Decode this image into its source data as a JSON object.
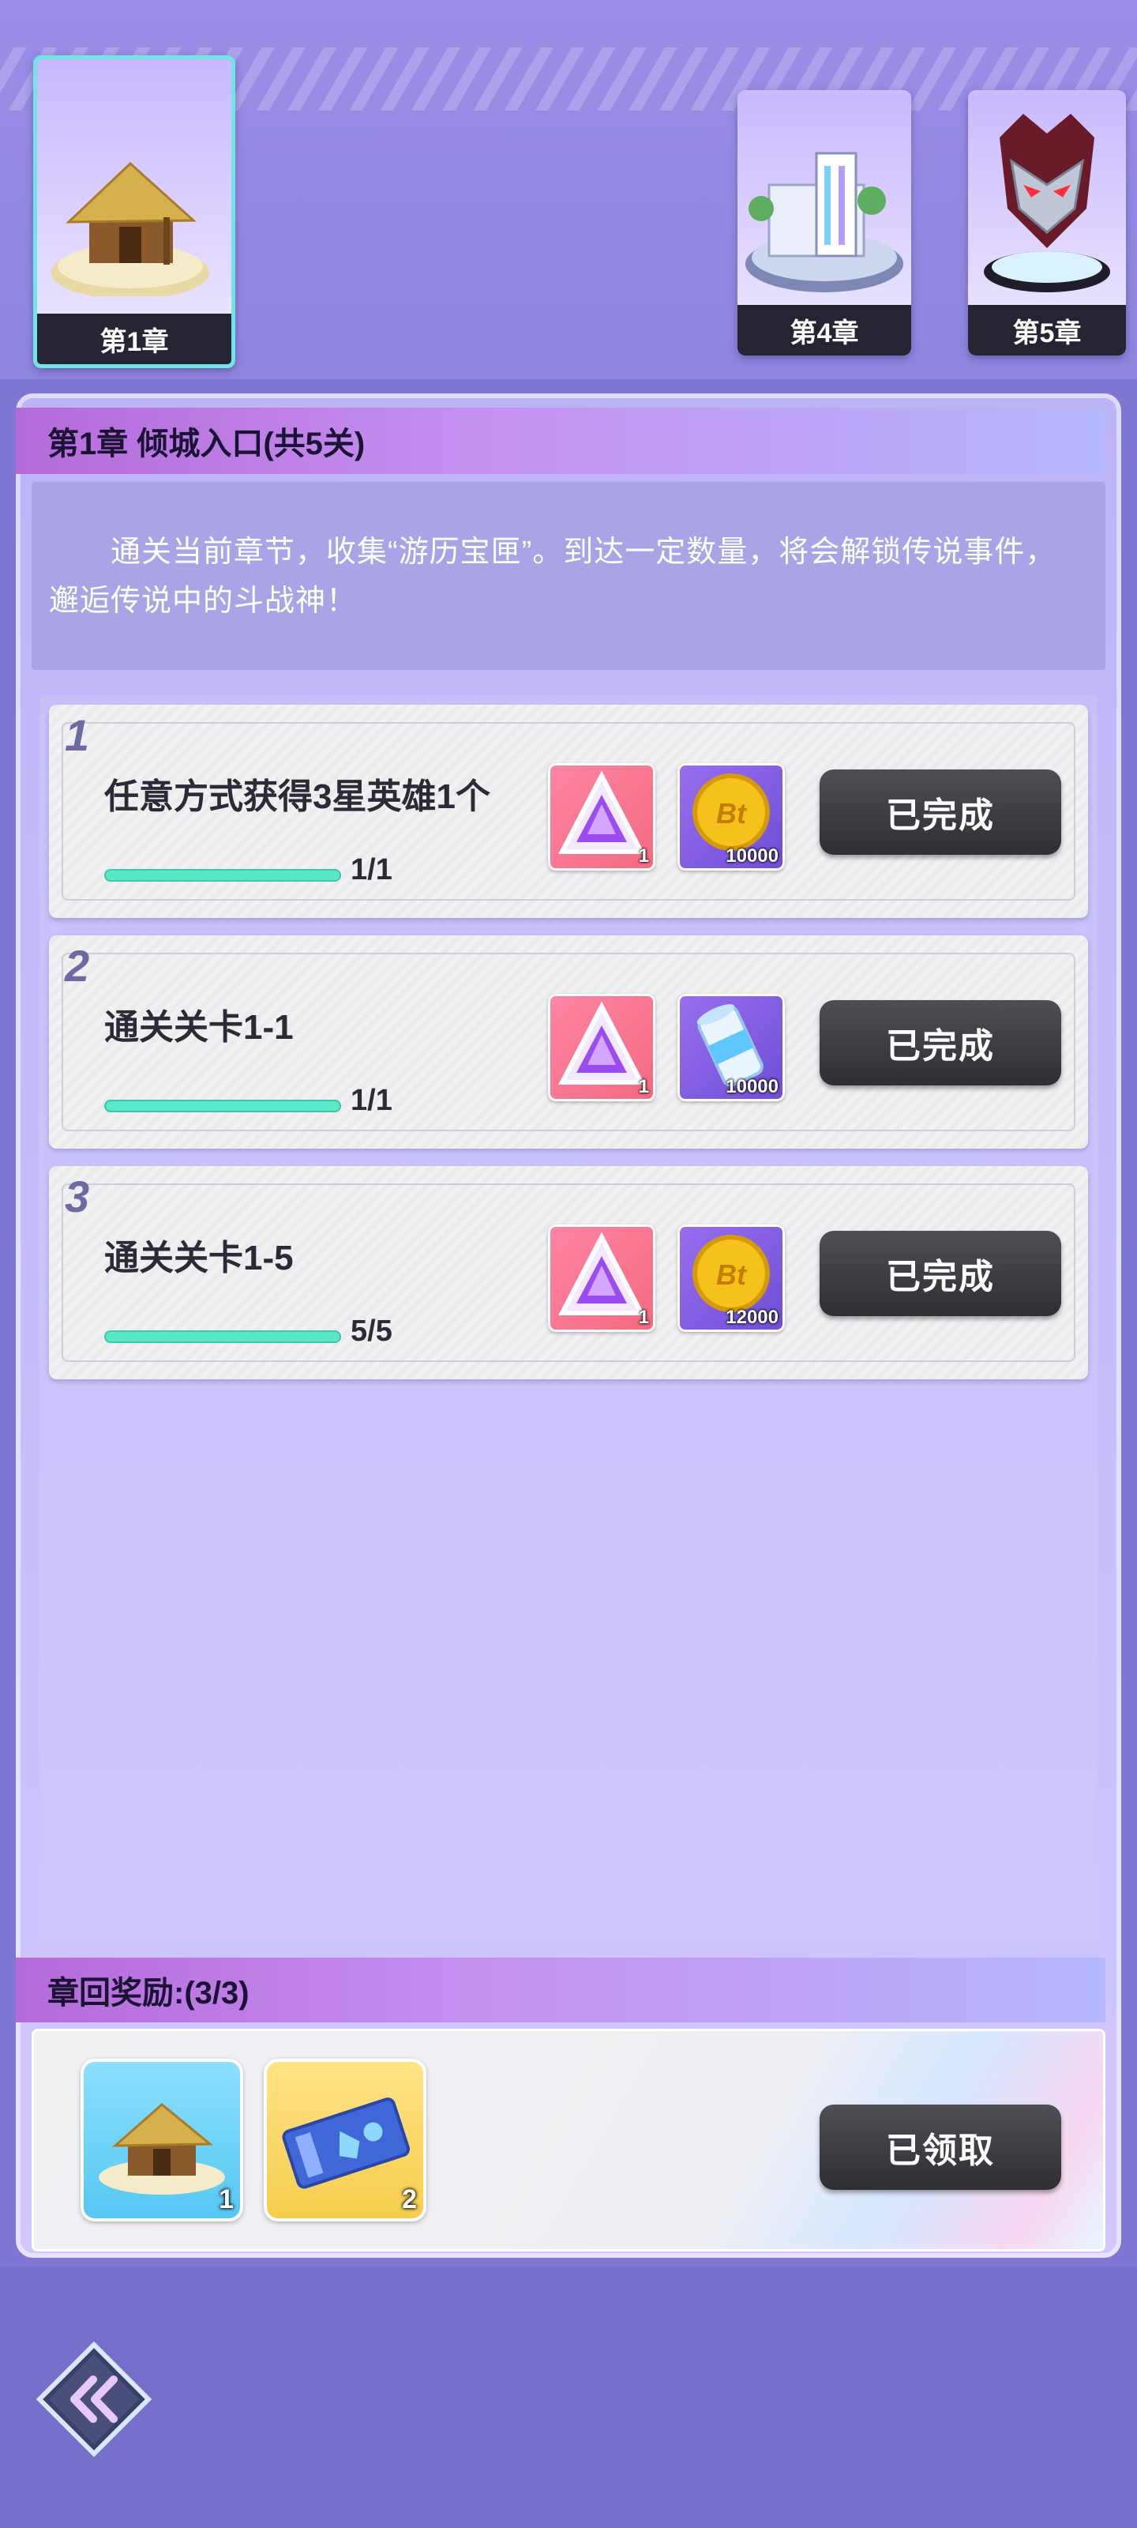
{
  "chapters": [
    {
      "label": "第1章",
      "state": "active"
    },
    {
      "label": "第4章",
      "state": "normal"
    },
    {
      "label": "第5章",
      "state": "normal"
    }
  ],
  "header": {
    "title": "第1章 倾城入口(共5关)"
  },
  "description": "通关当前章节，收集“游历宝匣”。到达一定数量，将会解锁传说事件，邂逅传说中的斗战神！",
  "tasks": [
    {
      "num": "1",
      "title": "任意方式获得3星英雄1个",
      "progress": "1/1",
      "progress_fraction": 1.0,
      "rewards": [
        {
          "icon": "purple-crystal-icon",
          "count": "1"
        },
        {
          "icon": "bt-coin-icon",
          "count": "10000"
        }
      ],
      "button": "已完成"
    },
    {
      "num": "2",
      "title": "通关关卡1-1",
      "progress": "1/1",
      "progress_fraction": 1.0,
      "rewards": [
        {
          "icon": "purple-crystal-icon",
          "count": "1"
        },
        {
          "icon": "exp-canister-icon",
          "count": "10000"
        }
      ],
      "button": "已完成"
    },
    {
      "num": "3",
      "title": "通关关卡1-5",
      "progress": "5/5",
      "progress_fraction": 1.0,
      "rewards": [
        {
          "icon": "purple-crystal-icon",
          "count": "1"
        },
        {
          "icon": "bt-coin-icon",
          "count": "12000"
        }
      ],
      "button": "已完成"
    }
  ],
  "chapter_reward": {
    "title": "章回奖励:(3/3)",
    "items": [
      {
        "icon": "straw-hut-icon",
        "count": "1"
      },
      {
        "icon": "ticket-icon",
        "count": "2"
      }
    ],
    "button": "已领取"
  },
  "colors": {
    "accent": "#59e8c8",
    "button": "#3a3a40",
    "panel": "#c3bafa"
  }
}
